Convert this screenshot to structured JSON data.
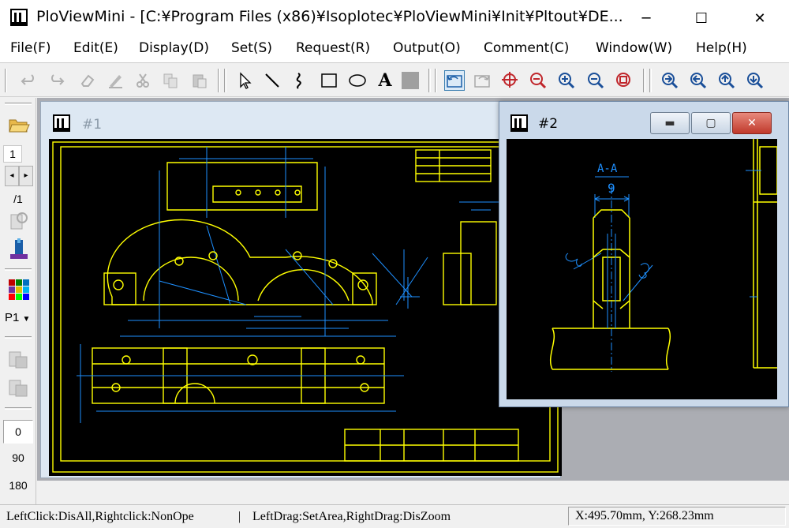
{
  "window": {
    "title": "PloViewMini - [C:¥Program Files (x86)¥Isoplotec¥PloViewMini¥Init¥Pltout¥DE...",
    "minimize_glyph": "─",
    "maximize_glyph": "☐",
    "close_glyph": "✕"
  },
  "menu": [
    {
      "label": "File(F)"
    },
    {
      "label": "Edit(E)"
    },
    {
      "label": "Display(D)"
    },
    {
      "label": "Set(S)"
    },
    {
      "label": "Request(R)"
    },
    {
      "label": "Output(O)"
    },
    {
      "label": "Comment(C)"
    },
    {
      "label": "Window(W)"
    },
    {
      "label": "Help(H)"
    }
  ],
  "toolbar": {
    "icons": [
      "undo-icon",
      "redo-icon",
      "eraser-icon",
      "pen-icon",
      "cut-icon",
      "copy-icon",
      "paste-icon",
      "pointer-icon",
      "line-icon",
      "freehand-icon",
      "rectangle-icon",
      "ellipse-icon",
      "text-icon",
      "fill-rect-icon",
      "rotate-left-icon",
      "rotate-right-icon",
      "zoom-target-icon",
      "zoom-area-icon",
      "zoom-in-icon",
      "zoom-out-icon",
      "zoom-fit-icon",
      "zoom-in-2-icon",
      "zoom-out-2-icon",
      "zoom-up-icon",
      "zoom-down-icon"
    ],
    "text_tool_glyph": "A"
  },
  "left_toolbar": {
    "page_number": "1",
    "page_total": "/1",
    "pen_label": "P1",
    "rotation": [
      "0",
      "90",
      "180"
    ]
  },
  "child1": {
    "title": "#1"
  },
  "child2": {
    "title": "#2",
    "section_label": "A-A",
    "dimension": "9"
  },
  "colors": {
    "drawing_bg": "#000000",
    "outline": "#ffff00",
    "dimension": "#1e90ff"
  },
  "status": {
    "hint1": "LeftClick:DisAll,Rightclick:NonOpe",
    "separator": "|",
    "hint2": "LeftDrag:SetArea,RightDrag:DisZoom",
    "coordinates": "X:495.70mm, Y:268.23mm"
  }
}
